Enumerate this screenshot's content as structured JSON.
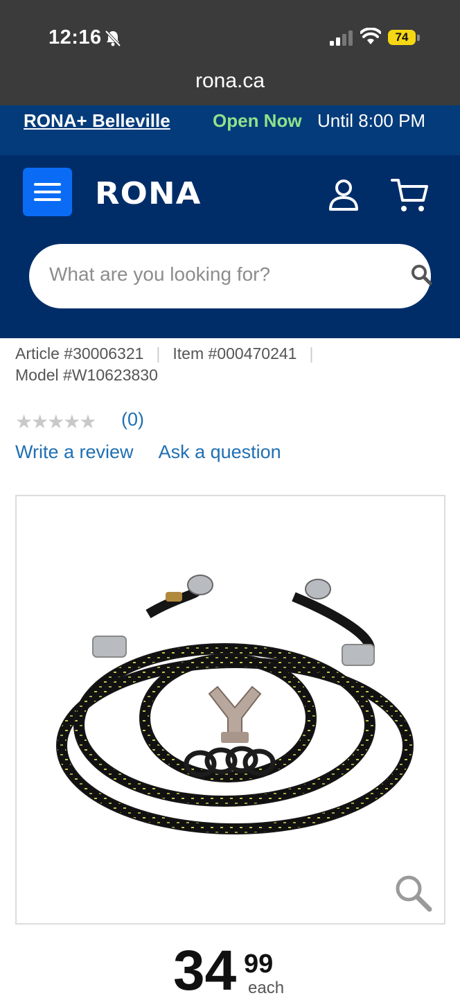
{
  "status_bar": {
    "time": "12:16",
    "battery": "74"
  },
  "browser": {
    "url": "rona.ca"
  },
  "store_bar": {
    "store_name": "RONA+ Belleville",
    "open_status": "Open Now",
    "hours": "Until 8:00 PM"
  },
  "header": {
    "logo": "RONA",
    "search_placeholder": "What are you looking for?"
  },
  "product": {
    "article": "Article #30006321",
    "item": "Item #000470241",
    "model": "Model #W10623830",
    "stars": "★★★★★",
    "rating_value": 0,
    "rating_count": "(0)",
    "write_review": "Write a review",
    "ask_question": "Ask a question",
    "price_dollars": "34",
    "price_cents": "99",
    "price_unit": "each"
  },
  "colors": {
    "header_bg": "#002d68",
    "store_bar_bg": "#043b7a",
    "menu_button": "#0a6cf5",
    "open_now": "#8fe28a",
    "link": "#1f6fb2"
  }
}
